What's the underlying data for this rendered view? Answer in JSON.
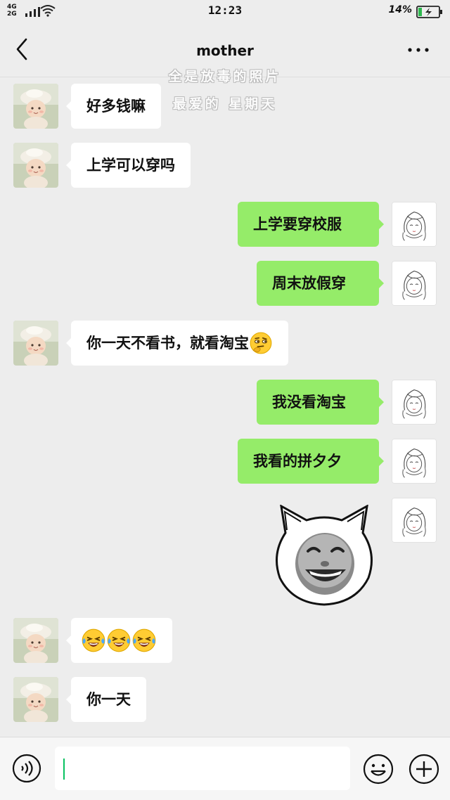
{
  "status_bar": {
    "network_top": "4G",
    "network_bottom": "2G",
    "time": "12:23",
    "battery_percent": "14%",
    "signal_icon": "signal-bars-icon",
    "wifi_icon": "wifi-icon",
    "battery_icon": "battery-charging-icon"
  },
  "header": {
    "title": "mother",
    "back_icon": "chevron-left-icon",
    "more_icon": "more-dots-icon"
  },
  "watermark": {
    "line1": "全是放毒的照片",
    "line2": "最爱的 星期天"
  },
  "messages": [
    {
      "side": "left",
      "text": "好多钱嘛"
    },
    {
      "side": "left",
      "text": "上学可以穿吗"
    },
    {
      "side": "right",
      "text": "上学要穿校服"
    },
    {
      "side": "right",
      "text": "周末放假穿"
    },
    {
      "side": "left",
      "text": "你一天不看书，就看淘宝",
      "emoji": "thinking-face-emoji"
    },
    {
      "side": "right",
      "text": "我没看淘宝"
    },
    {
      "side": "right",
      "text": "我看的拼夕夕"
    },
    {
      "side": "right",
      "sticker": "laughing-cat-face-sticker"
    },
    {
      "side": "left",
      "emojis": [
        "rolling-laughing-emoji",
        "rolling-laughing-emoji",
        "rolling-laughing-emoji"
      ]
    },
    {
      "side": "left",
      "text": "你一天"
    }
  ],
  "input_bar": {
    "voice_icon": "voice-icon",
    "emoji_icon": "emoji-icon",
    "plus_icon": "plus-icon",
    "input_value": ""
  },
  "colors": {
    "background": "#ededed",
    "own_bubble": "#95ec69",
    "other_bubble": "#ffffff",
    "cursor": "#07c160"
  }
}
